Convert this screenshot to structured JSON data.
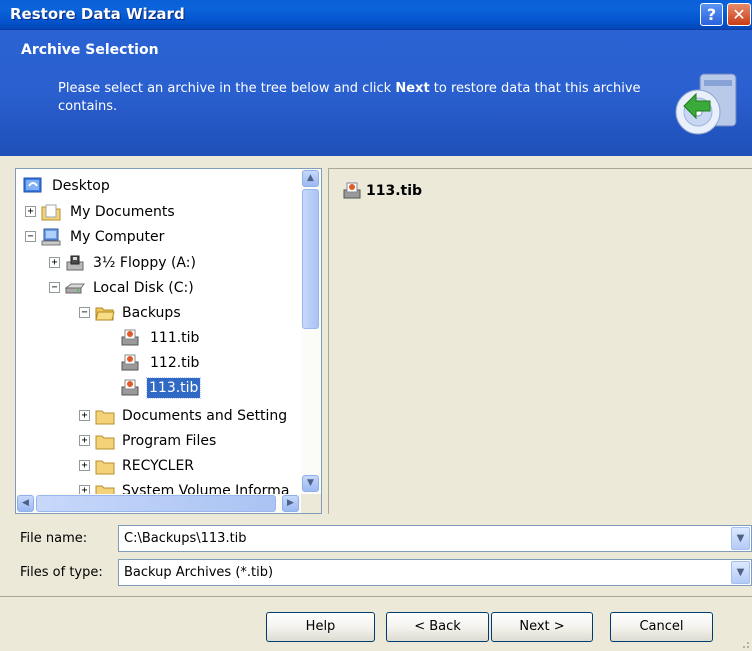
{
  "window": {
    "title": "Restore Data Wizard",
    "help_glyph": "?",
    "close_glyph": "✕"
  },
  "header": {
    "title": "Archive Selection",
    "desc_before": "Please select an archive in the tree below and click ",
    "desc_bold": "Next",
    "desc_after": " to restore data that this archive contains."
  },
  "tree": {
    "items": [
      {
        "label": "Desktop",
        "icon": "desktop-icon"
      },
      {
        "label": "My Documents",
        "icon": "my-documents-icon",
        "toggle": "+"
      },
      {
        "label": "My Computer",
        "icon": "my-computer-icon",
        "toggle": "−"
      },
      {
        "label": "3½ Floppy (A:)",
        "icon": "floppy-drive-icon",
        "toggle": "+"
      },
      {
        "label": "Local Disk (C:)",
        "icon": "hard-disk-icon",
        "toggle": "−"
      },
      {
        "label": "Backups",
        "icon": "open-folder-icon",
        "toggle": "−"
      },
      {
        "label": "111.tib",
        "icon": "backup-archive-icon"
      },
      {
        "label": "112.tib",
        "icon": "backup-archive-icon"
      },
      {
        "label": "113.tib",
        "icon": "backup-archive-icon",
        "selected": true
      },
      {
        "label": "Documents and Setting",
        "icon": "folder-icon",
        "toggle": "+"
      },
      {
        "label": "Program Files",
        "icon": "folder-icon",
        "toggle": "+"
      },
      {
        "label": "RECYCLER",
        "icon": "folder-icon",
        "toggle": "+"
      },
      {
        "label": "System Volume Informa",
        "icon": "folder-icon",
        "toggle": "+"
      }
    ]
  },
  "contents": {
    "items": [
      {
        "label": "113.tib",
        "icon": "backup-archive-icon"
      }
    ]
  },
  "file_name": {
    "label": "File name:",
    "value": "C:\\Backups\\113.tib"
  },
  "file_type": {
    "label": "Files of type:",
    "value": "Backup Archives (*.tib)"
  },
  "buttons": {
    "help": "Help",
    "back": "< Back",
    "next": "Next >",
    "cancel": "Cancel"
  },
  "colors": {
    "titlebar": "#0a5fd8",
    "header": "#2b63d4",
    "selection": "#316ac5",
    "dialog_bg": "#ece9d8"
  }
}
